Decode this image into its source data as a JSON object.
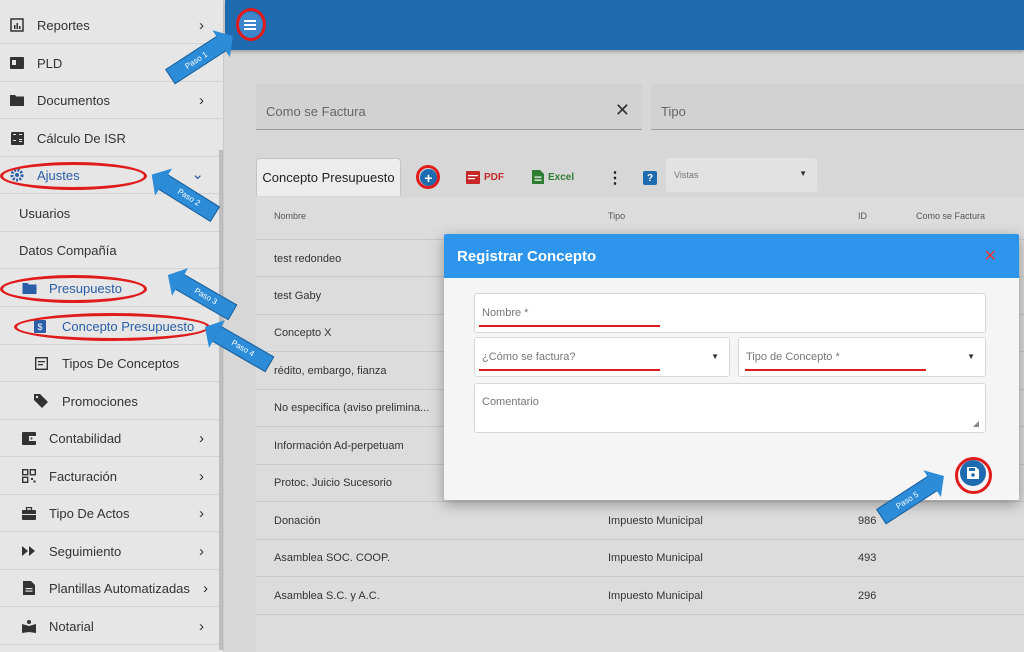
{
  "sidebar": {
    "items": [
      {
        "label": "Reportes",
        "icon": "chart-icon",
        "chevron": "›"
      },
      {
        "label": "PLD",
        "icon": "id-card-icon"
      },
      {
        "label": "Documentos",
        "icon": "folder-icon",
        "chevron": "›"
      },
      {
        "label": "Cálculo De ISR",
        "icon": "calculator-icon"
      },
      {
        "label": "Ajustes",
        "icon": "gear-icon",
        "chevron": "⌄"
      },
      {
        "label": "Usuarios"
      },
      {
        "label": "Datos Compañía"
      },
      {
        "label": "Presupuesto",
        "icon": "folder-icon"
      },
      {
        "label": "Concepto Presupuesto",
        "icon": "dollar-icon"
      },
      {
        "label": "Tipos De Conceptos",
        "icon": "list-icon"
      },
      {
        "label": "Promociones",
        "icon": "tag-icon"
      },
      {
        "label": "Contabilidad",
        "icon": "wallet-icon",
        "chevron": "›"
      },
      {
        "label": "Facturación",
        "icon": "qr-icon",
        "chevron": "›"
      },
      {
        "label": "Tipo De Actos",
        "icon": "briefcase-icon",
        "chevron": "›"
      },
      {
        "label": "Seguimiento",
        "icon": "fast-forward-icon",
        "chevron": "›"
      },
      {
        "label": "Plantillas Automatizadas",
        "icon": "document-icon",
        "chevron": "›"
      },
      {
        "label": "Notarial",
        "icon": "book-icon",
        "chevron": "›"
      }
    ]
  },
  "filters": {
    "como_se_factura": "Como se Factura",
    "tipo": "Tipo",
    "clear": "✕"
  },
  "toolbar": {
    "tab": "Concepto Presupuesto",
    "add": "+",
    "pdf": "PDF",
    "excel": "Excel",
    "more": "⋮",
    "help": "?",
    "views_placeholder": "Vistas"
  },
  "table": {
    "headers": {
      "nombre": "Nombre",
      "tipo": "Tipo",
      "id": "ID",
      "como_se_factura": "Como se Factura"
    },
    "rows": [
      {
        "nombre": "test redondeo",
        "tipo": "",
        "id": ""
      },
      {
        "nombre": "test Gaby",
        "tipo": "",
        "id": ""
      },
      {
        "nombre": "Concepto X",
        "tipo": "",
        "id": ""
      },
      {
        "nombre": "rédito, embargo, fianza",
        "tipo": "",
        "id": ""
      },
      {
        "nombre": "No especifica (aviso prelimina...",
        "tipo": "",
        "id": ""
      },
      {
        "nombre": "Información Ad-perpetuam",
        "tipo": "",
        "id": ""
      },
      {
        "nombre": "Protoc. Juicio Sucesorio",
        "tipo": "",
        "id": ""
      },
      {
        "nombre": "Donación",
        "tipo": "Impuesto Municipal",
        "id": "986"
      },
      {
        "nombre": "Asamblea SOC. COOP.",
        "tipo": "Impuesto Municipal",
        "id": "493"
      },
      {
        "nombre": "Asamblea S.C. y A.C.",
        "tipo": "Impuesto Municipal",
        "id": "296"
      }
    ]
  },
  "modal": {
    "title": "Registrar Concepto",
    "close": "✕",
    "nombre_placeholder": "Nombre *",
    "como_factura_placeholder": "¿Cómo se factura?",
    "tipo_concepto_placeholder": "Tipo de Concepto *",
    "comentario_placeholder": "Comentario"
  },
  "annotations": {
    "paso1": "Paso 1",
    "paso2": "Paso 2",
    "paso3": "Paso 3",
    "paso4": "Paso 4",
    "paso5": "Paso 5"
  },
  "colors": {
    "topbar": "#1e6bb0",
    "modal_header": "#2d95ec",
    "annotation_red": "#e01b1b",
    "annotation_arrow": "#2d8cd7",
    "active_blue": "#2a5ea8"
  }
}
